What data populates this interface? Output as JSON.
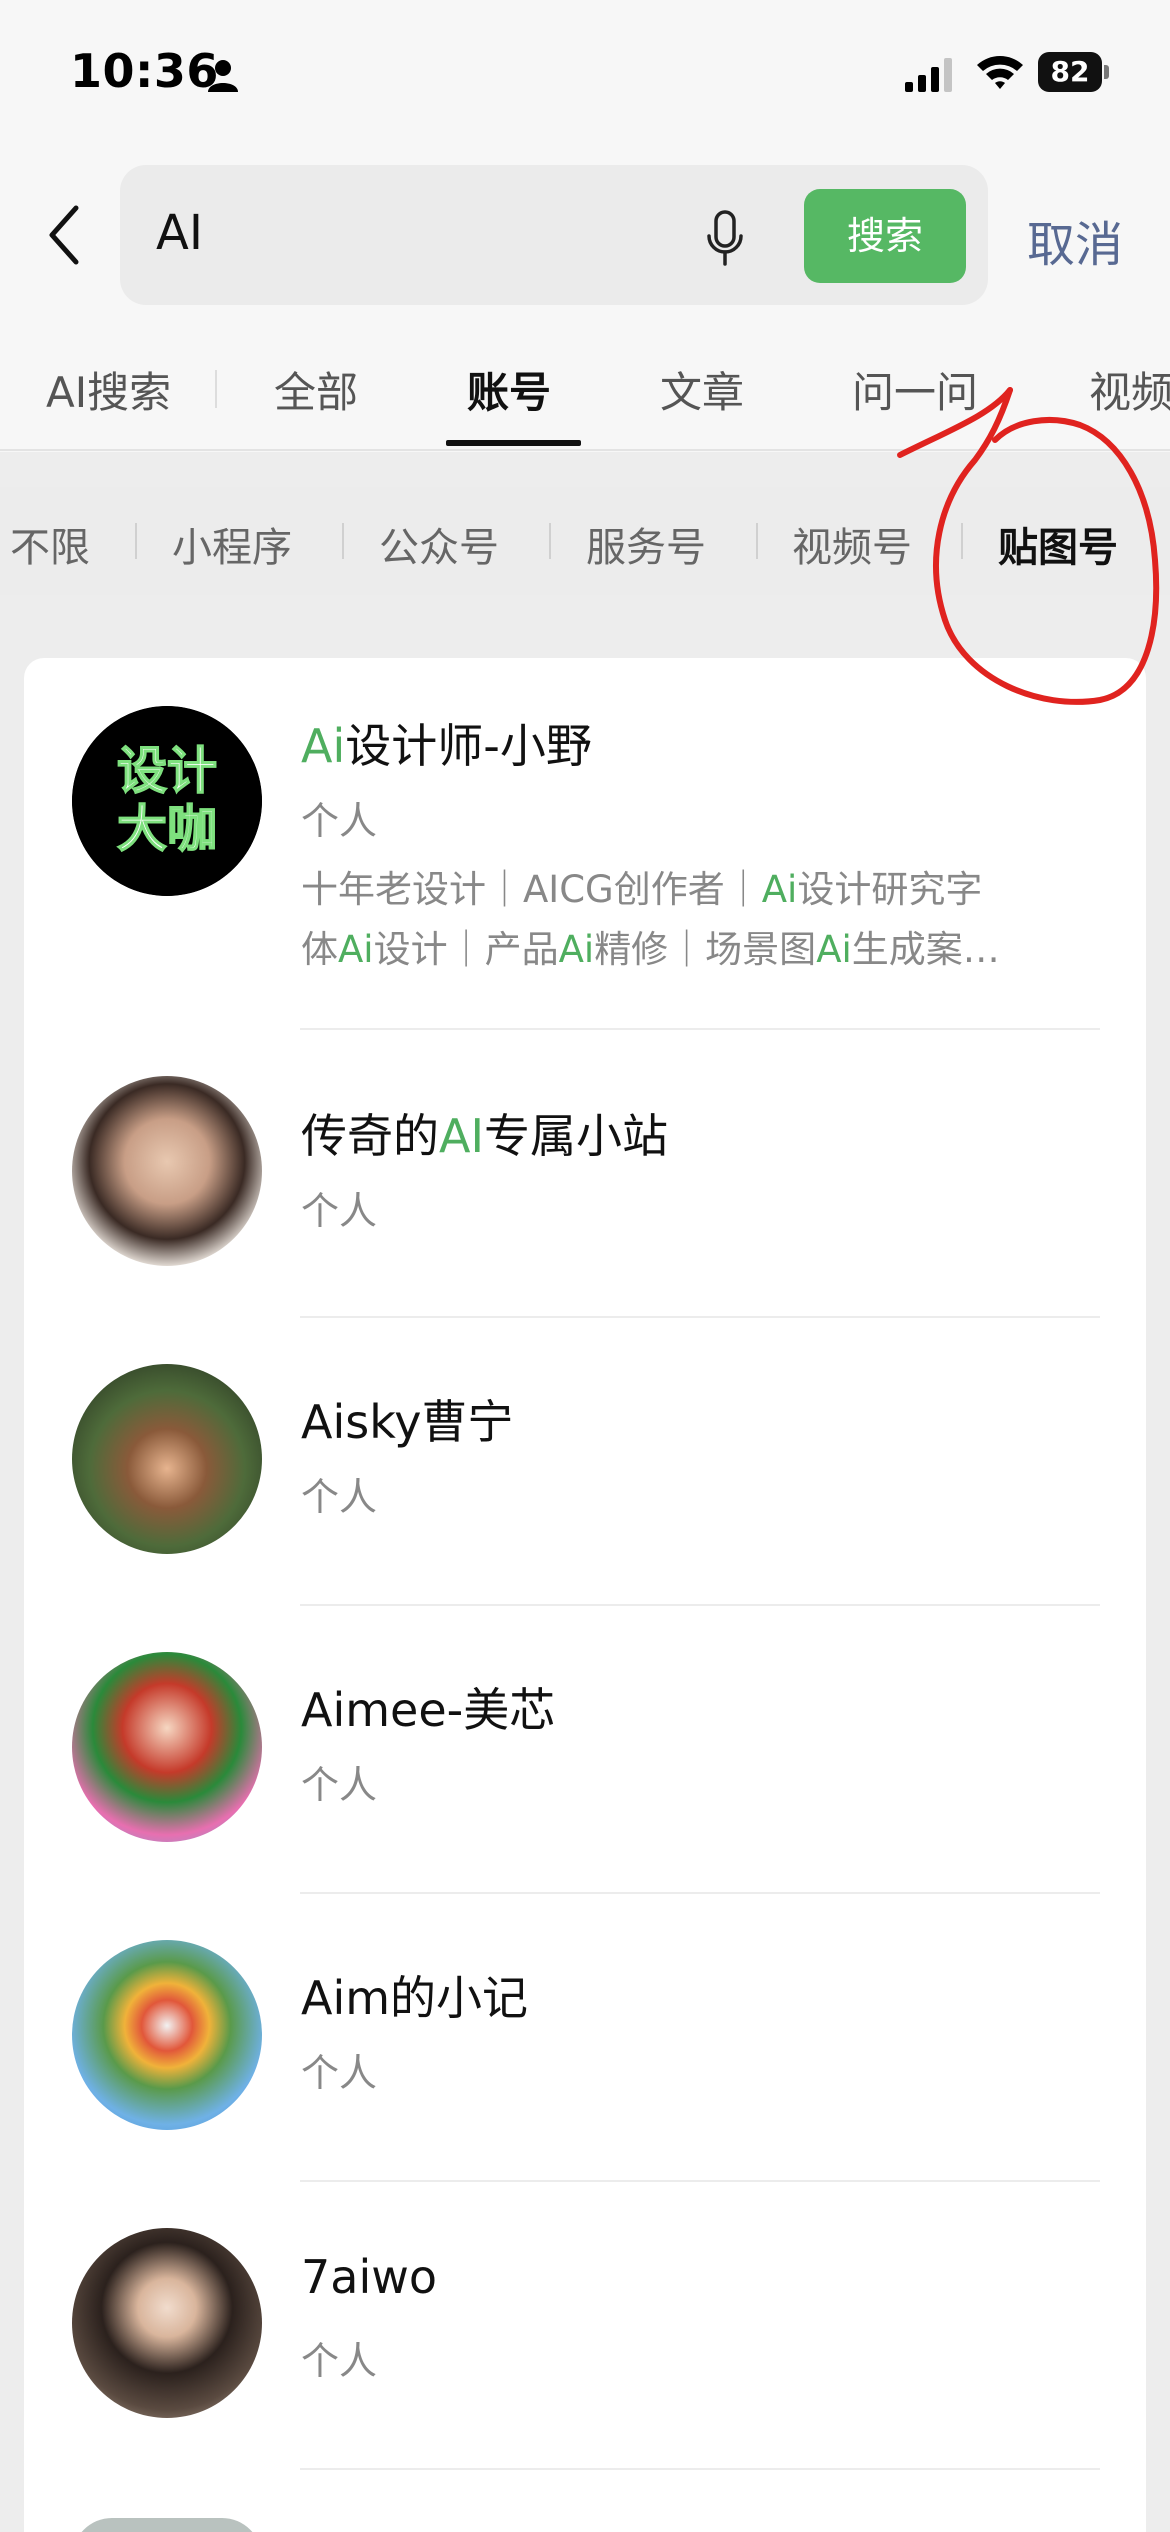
{
  "status_bar": {
    "time": "10:36",
    "battery": "82"
  },
  "search": {
    "query": "AI",
    "button": "搜索",
    "cancel": "取消"
  },
  "tabs": [
    "AI搜索",
    "全部",
    "账号",
    "文章",
    "问一问",
    "视频"
  ],
  "active_tab": "账号",
  "filters": [
    "不限",
    "小程序",
    "公众号",
    "服务号",
    "视频号",
    "贴图号"
  ],
  "active_filter": "贴图号",
  "results": [
    {
      "name_hl": "Ai",
      "name_rest": "设计师-小野",
      "type": "个人",
      "desc_line1": [
        [
          "十年老设计｜AICG创作者｜",
          false
        ],
        [
          "Ai",
          true
        ],
        [
          "设计研究字",
          false
        ]
      ],
      "desc_line2": [
        [
          "体",
          false
        ],
        [
          "Ai",
          true
        ],
        [
          "设计｜产品",
          false
        ],
        [
          "Ai",
          true
        ],
        [
          "精修｜场景图",
          false
        ],
        [
          "Ai",
          true
        ],
        [
          "生成案…",
          false
        ]
      ]
    },
    {
      "name_pre": "传奇的",
      "name_hl": "AI",
      "name_rest": "专属小站",
      "type": "个人"
    },
    {
      "name": "Aisky曹宁",
      "type": "个人"
    },
    {
      "name": "Aimee-美芯",
      "type": "个人"
    },
    {
      "name": "Aim的小记",
      "type": "个人"
    },
    {
      "name": "7aiwo",
      "type": "个人"
    }
  ],
  "logo_text": [
    "设计",
    "大咖"
  ],
  "colors": {
    "accent_green": "#56b864",
    "highlight_green": "#4fae5f",
    "cancel_blue": "#586992",
    "annotation_red": "#e0231f"
  }
}
